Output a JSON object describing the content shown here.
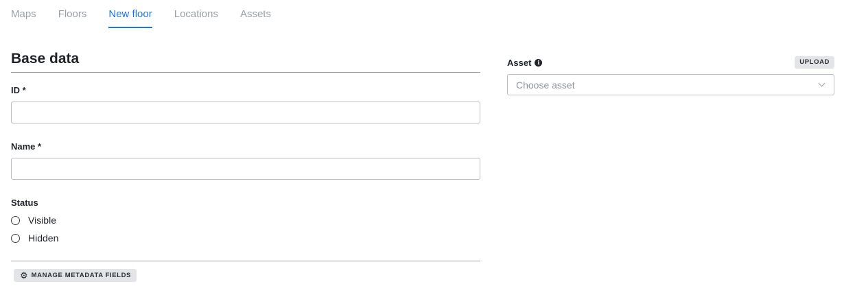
{
  "tabs": [
    {
      "label": "Maps",
      "active": false
    },
    {
      "label": "Floors",
      "active": false
    },
    {
      "label": "New floor",
      "active": true
    },
    {
      "label": "Locations",
      "active": false
    },
    {
      "label": "Assets",
      "active": false
    }
  ],
  "base_data": {
    "title": "Base data",
    "id_label": "ID *",
    "id_value": "",
    "name_label": "Name *",
    "name_value": "",
    "status_label": "Status",
    "status_options": [
      "Visible",
      "Hidden"
    ],
    "manage_metadata_label": "MANAGE METADATA FIELDS"
  },
  "asset": {
    "label": "Asset",
    "upload_label": "UPLOAD",
    "placeholder": "Choose asset"
  },
  "colors": {
    "accent": "#1a73e8",
    "inactive_tab": "#9aa0a6"
  },
  "icons": {
    "info": "info-icon",
    "gear": "gear-icon",
    "chevron": "chevron-down-icon"
  }
}
